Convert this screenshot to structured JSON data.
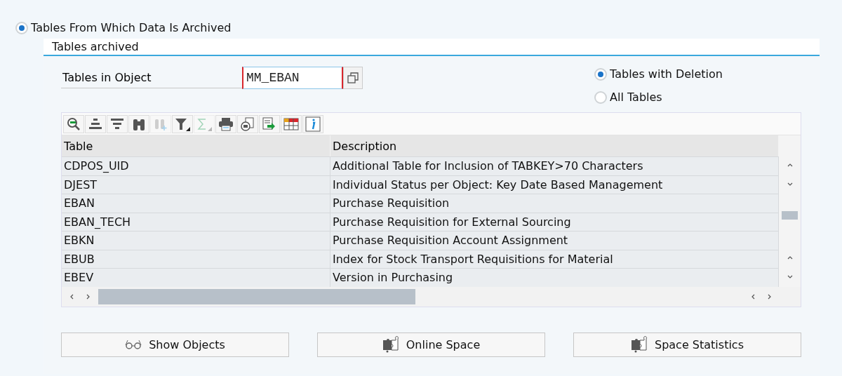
{
  "mode_option": {
    "label": "Tables From Which Data Is Archived",
    "selected": true
  },
  "panel": {
    "title": "Tables archived",
    "object_field": {
      "label": "Tables in Object",
      "value": "MM_EBAN"
    },
    "table_options": [
      {
        "label": "Tables with Deletion",
        "selected": true
      },
      {
        "label": "All Tables",
        "selected": false
      }
    ],
    "toolbar": [
      {
        "kind": "details",
        "disabled": false
      },
      {
        "kind": "sort-asc",
        "disabled": false
      },
      {
        "kind": "sort-desc",
        "disabled": false
      },
      {
        "kind": "find",
        "disabled": false
      },
      {
        "kind": "find-next",
        "disabled": true
      },
      {
        "kind": "filter",
        "disabled": false
      },
      {
        "kind": "sum",
        "disabled": true
      },
      {
        "kind": "print",
        "disabled": false
      },
      {
        "kind": "views",
        "disabled": false
      },
      {
        "kind": "export",
        "disabled": false
      },
      {
        "kind": "layout",
        "disabled": false
      },
      {
        "kind": "info",
        "disabled": false
      }
    ],
    "table": {
      "columns": [
        "Table",
        "Description"
      ],
      "rows": [
        [
          "CDPOS_UID",
          "Additional Table for Inclusion of TABKEY>70 Characters"
        ],
        [
          "DJEST",
          "Individual Status per Object: Key Date Based Management"
        ],
        [
          "EBAN",
          "Purchase Requisition"
        ],
        [
          "EBAN_TECH",
          "Purchase Requisition for External Sourcing"
        ],
        [
          "EBKN",
          "Purchase Requisition Account Assignment"
        ],
        [
          "EBUB",
          "Index for Stock Transport Requisitions for Material"
        ],
        [
          "EBEV",
          "Version in Purchasing"
        ]
      ]
    },
    "buttons": [
      {
        "kind": "glasses",
        "label": "Show Objects"
      },
      {
        "kind": "puzzle",
        "label": "Online Space"
      },
      {
        "kind": "puzzle",
        "label": "Space Statistics"
      }
    ]
  }
}
